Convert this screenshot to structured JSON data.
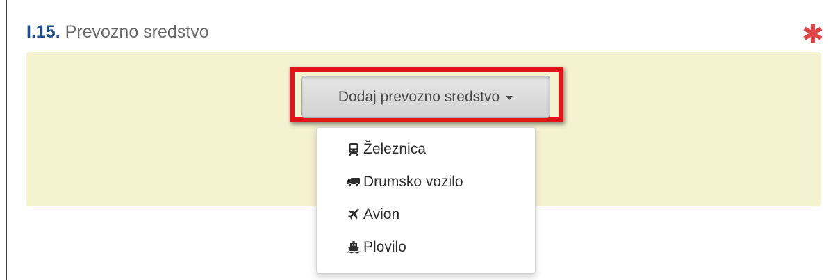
{
  "section": {
    "number": "I.15.",
    "title": "Prevozno sredstvo",
    "required_mark": "✱"
  },
  "add_button": {
    "label": "Dodaj prevozno sredstvo"
  },
  "dropdown": {
    "items": [
      {
        "label": "Železnica",
        "icon": "train-icon"
      },
      {
        "label": "Drumsko vozilo",
        "icon": "truck-icon"
      },
      {
        "label": "Avion",
        "icon": "plane-icon"
      },
      {
        "label": "Plovilo",
        "icon": "ship-icon"
      }
    ]
  },
  "colors": {
    "panel_background": "#f5f2d0",
    "highlight_border": "#e3131a",
    "section_number": "#1f4e8c",
    "required_star": "#e04545"
  }
}
